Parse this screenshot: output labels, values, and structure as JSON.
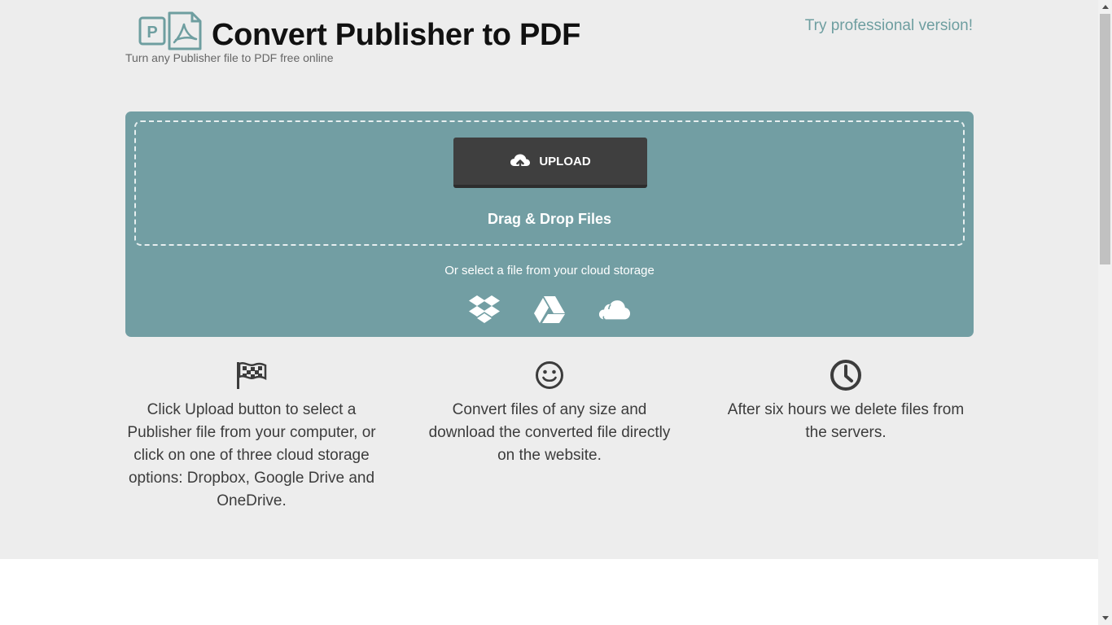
{
  "header": {
    "title": "Convert Publisher to PDF",
    "subtitle": "Turn any Publisher file to PDF free online",
    "pro_link": "Try professional version!",
    "logo_letter": "P"
  },
  "upload": {
    "button_label": "UPLOAD",
    "drop_text": "Drag & Drop Files",
    "cloud_text": "Or select a file from your cloud storage",
    "cloud_options": [
      "dropbox-icon",
      "google-drive-icon",
      "onedrive-icon"
    ]
  },
  "features": [
    {
      "icon": "flag-icon",
      "text": "Click Upload button to select a Publisher file from your computer, or click on one of three cloud storage options: Dropbox, Google Drive and OneDrive."
    },
    {
      "icon": "smiley-icon",
      "text": "Convert files of any size and download the converted file directly on the website."
    },
    {
      "icon": "clock-icon",
      "text": "After six hours we delete files from the servers."
    }
  ],
  "colors": {
    "accent": "#729ea3",
    "button": "#3f3f3f",
    "background": "#ededed",
    "link": "#6e9ea0"
  }
}
